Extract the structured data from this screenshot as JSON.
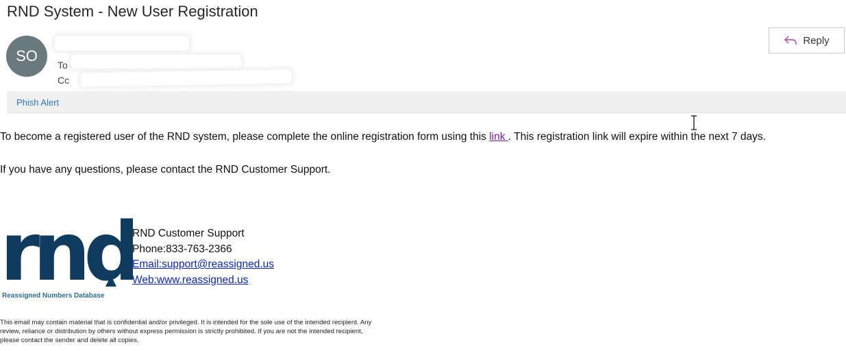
{
  "email": {
    "subject": "RND System - New User Registration",
    "sender_initials": "SO",
    "to_label": "To",
    "cc_label": "Cc"
  },
  "toolbar": {
    "reply_label": "Reply",
    "phish_alert_label": "Phish Alert"
  },
  "body": {
    "p1_before": "To become a registered user of the RND system, please complete the online registration form using this ",
    "p1_link": "link ",
    "p1_after": ". This registration link will expire within the next 7 days.",
    "p2": "If you have any questions, please contact the RND Customer Support."
  },
  "signature": {
    "logo_text": "rnd",
    "logo_caption": "Reassigned Numbers Database",
    "name": "RND Customer Support",
    "phone": "Phone:833-763-2366",
    "email": "Email:support@reassigned.us",
    "web": "Web:www.reassigned.us"
  },
  "disclaimer": "This email may contain material that is confidential and/or privileged. It is intended for the sole use of the intended recipient. Any review, reliance or distribution by others without express permission is strictly prohibited. If you are not the intended recipient, please contact the sender and delete all copies.",
  "colors": {
    "avatar_bg": "#69797e",
    "phish_link": "#2b77c8",
    "logo_blue": "#0f3b5f",
    "visited_link": "#7b1fa2",
    "sig_link": "#0b27c9"
  },
  "icons": [
    "reply-arrow-icon",
    "text-cursor-icon"
  ]
}
